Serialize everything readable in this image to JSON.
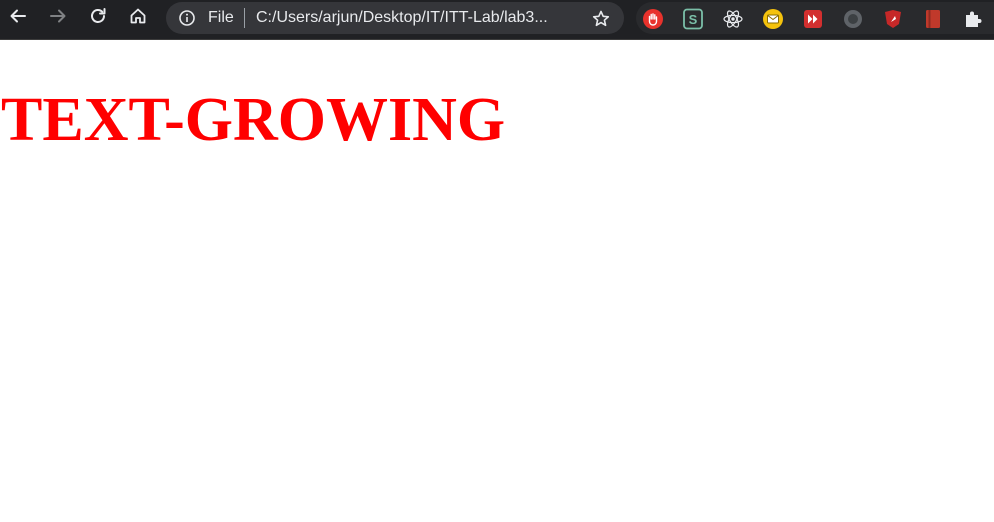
{
  "browser": {
    "back_icon": "back-arrow-icon",
    "forward_icon": "forward-arrow-icon",
    "reload_icon": "reload-icon",
    "home_icon": "home-icon",
    "omnibox": {
      "info_icon": "info-icon",
      "scheme_label": "File",
      "url": "C:/Users/arjun/Desktop/IT/ITT-Lab/lab3...",
      "bookmark_icon": "star-icon"
    },
    "extensions": [
      "adblock-icon",
      "s-extension-icon",
      "react-devtools-icon",
      "mail-icon",
      "fast-forward-icon",
      "circle-extension-icon",
      "rocket-shield-icon",
      "book-icon",
      "puzzle-piece-icon"
    ]
  },
  "page": {
    "heading": "TEXT-GROWING"
  },
  "colors": {
    "toolbar_bg": "#202124",
    "omnibox_bg": "#35363a",
    "heading_color": "#ff0000"
  }
}
